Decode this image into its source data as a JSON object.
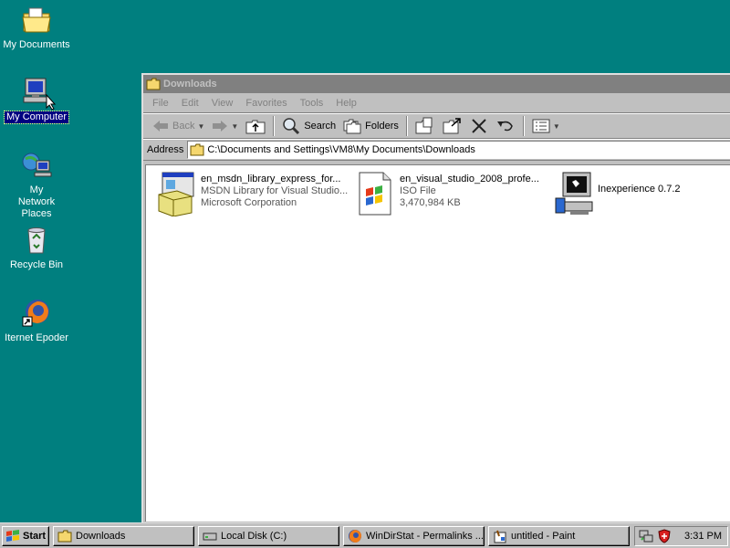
{
  "desktop": {
    "icons": [
      {
        "label": "My Documents",
        "icon": "my-documents-folder-icon"
      },
      {
        "label": "My Computer",
        "icon": "my-computer-icon",
        "selected": true
      },
      {
        "label": "My Network Places",
        "icon": "network-places-icon"
      },
      {
        "label": "Recycle Bin",
        "icon": "recycle-bin-icon"
      },
      {
        "label": "Iternet Epoder",
        "icon": "firefox-shortcut-icon"
      }
    ]
  },
  "window": {
    "title": "Downloads",
    "menu": [
      "File",
      "Edit",
      "View",
      "Favorites",
      "Tools",
      "Help"
    ],
    "toolbar": {
      "back": "Back",
      "search": "Search",
      "folders": "Folders"
    },
    "address": {
      "label": "Address",
      "value": "C:\\Documents and Settings\\VM8\\My Documents\\Downloads"
    },
    "files": [
      {
        "name": "en_msdn_library_express_for...",
        "line2": "MSDN Library for Visual Studio...",
        "line3": "Microsoft Corporation",
        "icon": "installer-package-icon"
      },
      {
        "name": "en_visual_studio_2008_profe...",
        "line2": "ISO File",
        "line3": "3,470,984 KB",
        "icon": "iso-file-icon"
      },
      {
        "name": "Inexperience 0.7.2",
        "line2": "",
        "line3": "",
        "icon": "setup-computer-icon"
      }
    ]
  },
  "taskbar": {
    "start": "Start",
    "tasks": [
      {
        "label": "Downloads",
        "icon": "folder-icon"
      },
      {
        "label": "Local Disk (C:)",
        "icon": "drive-icon"
      },
      {
        "label": "WinDirStat - Permalinks ...",
        "icon": "firefox-icon"
      },
      {
        "label": "untitled - Paint",
        "icon": "paint-icon"
      }
    ],
    "clock": "3:31 PM"
  },
  "colors": {
    "desktop": "#007f7f",
    "inactive_title": "#808080",
    "face": "#c0c0c0",
    "selection": "#000080"
  }
}
